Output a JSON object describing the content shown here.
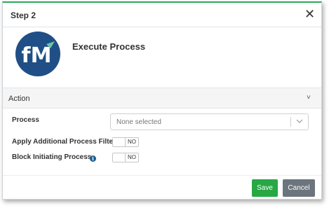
{
  "header": {
    "title": "Step 2",
    "close_icon": "close-icon"
  },
  "hero": {
    "logo_text": "fM",
    "title": "Execute Process",
    "logo_bg": "#1f4f86"
  },
  "section": {
    "title": "Action",
    "chevron_icon": "chevron-down-icon"
  },
  "fields": {
    "process_label": "Process",
    "process_placeholder": "None selected",
    "filter_label": "Apply Additional Process Filter",
    "filter_value": "NO",
    "block_label": "Block  Initiating Process",
    "block_value": "NO"
  },
  "footer": {
    "save_label": "Save",
    "cancel_label": "Cancel",
    "save_color": "#28a745",
    "cancel_color": "#6c757d"
  },
  "colors": {
    "accent_top": "#2ea85e",
    "info_icon": "#1f5e8c"
  }
}
